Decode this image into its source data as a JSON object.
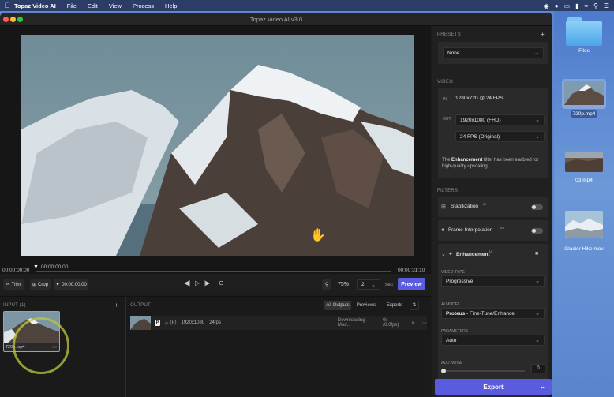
{
  "menubar": {
    "app_name": "Topaz Video AI",
    "items": [
      "File",
      "Edit",
      "View",
      "Process",
      "Help"
    ]
  },
  "window": {
    "title": "Topaz Video AI  v3.0"
  },
  "timeline": {
    "current_time": "00:00:00:00",
    "start_time": "00:00:00:00",
    "end_time": "00:00:31:10"
  },
  "controls": {
    "trim_label": "Trim",
    "crop_label": "Crop",
    "marker_time": "00:00:00:00",
    "zoom": "75%",
    "zoom_select": "2",
    "sec_label": "sec",
    "preview_label": "Preview"
  },
  "inputs": {
    "header": "INPUT (1)",
    "add": "+",
    "file_name": "720p.mp4"
  },
  "outputs": {
    "header": "OUTPUT",
    "tabs": [
      "All Outputs",
      "Previews",
      "Exports"
    ],
    "row": {
      "badge": "P",
      "settings": "(P)",
      "resolution": "1920x1080",
      "fps": "24fps",
      "status": "Downloading Mod...",
      "progress": "0s (0.0fps)"
    }
  },
  "panel": {
    "presets_label": "PRESETS",
    "preset_value": "None",
    "video_label": "VIDEO",
    "in_tag": "IN",
    "in_value": "1280x720 @ 24 FPS",
    "out_tag": "OUT",
    "out_resolution": "1920x1080 (FHD)",
    "out_fps": "24 FPS (Original)",
    "note_pre": "The ",
    "note_bold": "Enhancement",
    "note_post": " filter has been enabled for high-quality upscaling.",
    "filters_label": "FILTERS",
    "stabilization": "Stabilization",
    "frame_interp": "Frame Interpolation",
    "ai_mark": "AI",
    "enhancement": "Enhancement",
    "video_type_label": "VIDEO TYPE",
    "video_type_value": "Progressive",
    "ai_model_label": "AI MODEL",
    "ai_model_name": "Proteus",
    "ai_model_rest": " - Fine-Tune/Enhance",
    "parameters_label": "PARAMETERS",
    "parameters_value": "Auto",
    "add_noise_label": "ADD NOISE",
    "add_noise_value": "0",
    "export_label": "Export"
  },
  "desktop": {
    "items": [
      "Files",
      "720p.mp4",
      "03.mp4",
      "Glacier Hike.mov"
    ]
  },
  "colors": {
    "accent": "#5b5be0",
    "window_bg": "#1c1c1c",
    "desktop_bg": "#5e86c9"
  }
}
